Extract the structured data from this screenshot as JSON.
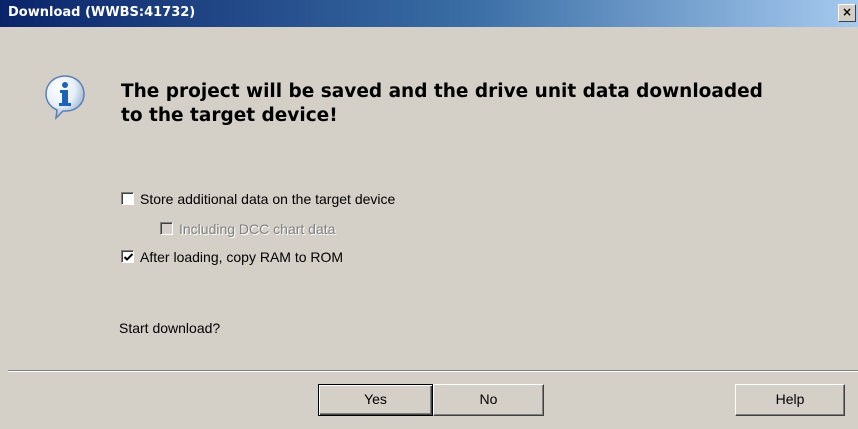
{
  "window": {
    "title": "Download (WWBS:41732)",
    "close_glyph": "×"
  },
  "message": {
    "icon": "info-icon",
    "text": "The project will be saved and the drive unit data downloaded to the target device!"
  },
  "options": [
    {
      "label": "Store additional data on the target device",
      "checked": false,
      "enabled": true
    },
    {
      "label": "Including DCC chart data",
      "checked": false,
      "enabled": false
    },
    {
      "label": "After loading, copy RAM to ROM",
      "checked": true,
      "enabled": true
    }
  ],
  "prompt": "Start download?",
  "buttons": {
    "yes": "Yes",
    "no": "No",
    "help": "Help"
  },
  "colors": {
    "dialog_bg": "#d4d0c8",
    "title_start": "#0a246a",
    "title_end": "#a6caf0",
    "icon_blue": "#1c62b8"
  }
}
